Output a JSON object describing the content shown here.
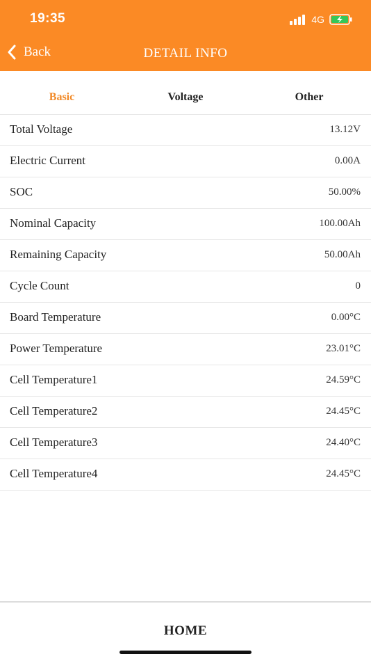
{
  "status_bar": {
    "time": "19:35",
    "network": "4G",
    "signal_icon": "signal-bars-icon",
    "battery_icon": "battery-charging-icon",
    "battery_color": "#34c759"
  },
  "nav": {
    "back_label": "Back",
    "title": "DETAIL INFO",
    "background": "#fb8a25"
  },
  "tabs": [
    {
      "label": "Basic",
      "active": true
    },
    {
      "label": "Voltage",
      "active": false
    },
    {
      "label": "Other",
      "active": false
    }
  ],
  "rows": [
    {
      "label": "Total Voltage",
      "value": "13.12V"
    },
    {
      "label": "Electric Current",
      "value": "0.00A"
    },
    {
      "label": "SOC",
      "value": "50.00%"
    },
    {
      "label": "Nominal Capacity",
      "value": "100.00Ah"
    },
    {
      "label": "Remaining Capacity",
      "value": "50.00Ah"
    },
    {
      "label": "Cycle Count",
      "value": "0"
    },
    {
      "label": "Board Temperature",
      "value": "0.00°C"
    },
    {
      "label": "Power Temperature",
      "value": "23.01°C"
    },
    {
      "label": "Cell Temperature1",
      "value": "24.59°C"
    },
    {
      "label": "Cell Temperature2",
      "value": "24.45°C"
    },
    {
      "label": "Cell Temperature3",
      "value": "24.40°C"
    },
    {
      "label": "Cell Temperature4",
      "value": "24.45°C"
    }
  ],
  "bottom": {
    "home_label": "HOME"
  }
}
